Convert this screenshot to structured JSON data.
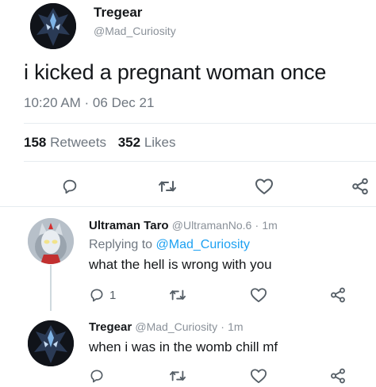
{
  "main_tweet": {
    "display_name": "Tregear",
    "handle": "@Mad_Curiosity",
    "text": "i kicked a pregnant woman once",
    "timestamp": "10:20 AM · 06 Dec 21",
    "retweets_count": "158",
    "retweets_label": "Retweets",
    "likes_count": "352",
    "likes_label": "Likes"
  },
  "reply_1": {
    "display_name": "Ultraman Taro",
    "handle": "@UltramanNo.6",
    "dot": "·",
    "time": "1m",
    "replying_to_label": "Replying to",
    "replying_to_handle": "@Mad_Curiosity",
    "text": "what the hell is wrong with you",
    "reply_count": "1"
  },
  "reply_2": {
    "display_name": "Tregear",
    "handle": "@Mad_Curiosity",
    "dot": "·",
    "time": "1m",
    "text": "when i was in the womb chill mf"
  },
  "icons": {
    "reply": "comment-bubble-icon",
    "retweet": "retweet-arrows-icon",
    "like": "heart-outline-icon",
    "share": "share-nodes-icon"
  },
  "colors": {
    "text": "#14171a",
    "muted": "#8a9199",
    "link": "#1da1f2",
    "divider": "#e6ecf0"
  }
}
